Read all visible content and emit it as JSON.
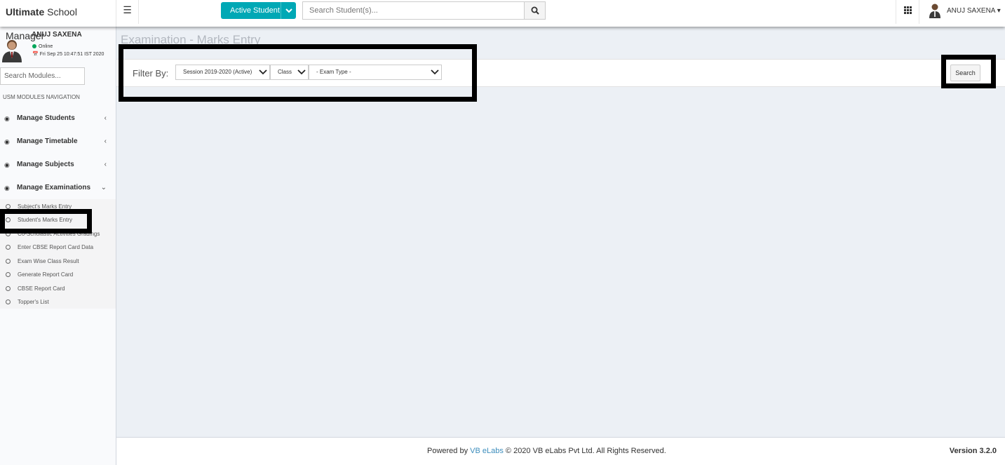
{
  "header": {
    "logo_bold": "Ultimate",
    "logo_rest": " School Manager",
    "active_student_label": "Active Student",
    "student_search_placeholder": "Search Student(s)...",
    "user_name": "ANUJ SAXENA"
  },
  "sidebar": {
    "user_name": "ANUJ SAXENA",
    "status": "Online",
    "datetime": "Fri Sep 25 10:47:51 IST 2020",
    "search_placeholder": "Search Modules...",
    "nav_header": "USM MODULES NAVIGATION",
    "items": [
      {
        "label": "Manage Students",
        "expanded": false
      },
      {
        "label": "Manage Timetable",
        "expanded": false
      },
      {
        "label": "Manage Subjects",
        "expanded": false
      },
      {
        "label": "Manage Examinations",
        "expanded": true
      }
    ],
    "sub_items": [
      {
        "label": "Subject's Marks Entry"
      },
      {
        "label": "Student's Marks Entry"
      },
      {
        "label": "Co-Scholastic Activities Gradings"
      },
      {
        "label": "Enter CBSE Report Card Data"
      },
      {
        "label": "Exam Wise Class Result"
      },
      {
        "label": "Generate Report Card"
      },
      {
        "label": "CBSE Report Card"
      },
      {
        "label": "Topper's List"
      }
    ]
  },
  "content": {
    "title": "Examination - Marks Entry",
    "filter_label": "Filter By:",
    "session_value": "Session 2019-2020 (Active)",
    "class_value": "Class",
    "exam_type_value": "- Exam Type -",
    "search_label": "Search"
  },
  "footer": {
    "powered_by": "Powered by ",
    "company_link": "VB eLabs",
    "copyright": " © 2020 VB eLabs Pvt Ltd. All Rights Reserved.",
    "version": "Version 3.2.0"
  },
  "colors": {
    "accent": "#00a8b5",
    "link": "#3c8dbc",
    "online": "#00a65a",
    "content_bg": "#ecf0f5"
  }
}
